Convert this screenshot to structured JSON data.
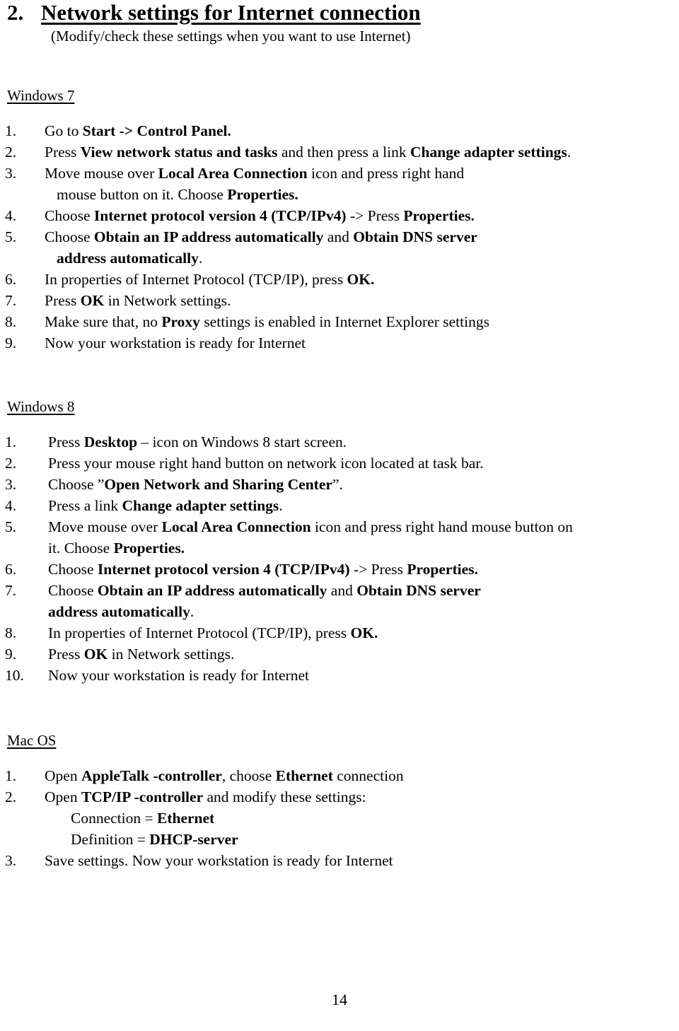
{
  "heading": {
    "number": "2.",
    "title": "Network settings for Internet connection",
    "subtitle": "(Modify/check these settings when you want to use Internet)"
  },
  "sections": [
    {
      "id": "win7",
      "heading": "Windows 7",
      "steps": [
        {
          "marker": "1.",
          "parts": [
            {
              "t": "Go to ",
              "b": false
            },
            {
              "t": "Start -> Control Panel.",
              "b": true
            }
          ]
        },
        {
          "marker": "2.",
          "parts": [
            {
              "t": "Press ",
              "b": false
            },
            {
              "t": "View network status and tasks",
              "b": true
            },
            {
              "t": " and then press a link ",
              "b": false
            },
            {
              "t": "Change adapter settings",
              "b": true
            },
            {
              "t": ".",
              "b": false
            }
          ]
        },
        {
          "marker": "3.",
          "parts": [
            {
              "t": "Move mouse over ",
              "b": false
            },
            {
              "t": "Local Area Connection",
              "b": true
            },
            {
              "t": " icon and press right hand",
              "b": false
            }
          ],
          "cont": [
            {
              "t": "mouse button on it. Choose ",
              "b": false
            },
            {
              "t": "Properties.",
              "b": true
            }
          ]
        },
        {
          "marker": "4.",
          "parts": [
            {
              "t": "Choose ",
              "b": false
            },
            {
              "t": "Internet protocol version 4 (TCP/IPv4)",
              "b": true
            },
            {
              "t": " -> Press ",
              "b": false
            },
            {
              "t": "Properties.",
              "b": true
            }
          ]
        },
        {
          "marker": "5.",
          "parts": [
            {
              "t": "Choose ",
              "b": false
            },
            {
              "t": "Obtain an IP address automatically",
              "b": true
            },
            {
              "t": " and ",
              "b": false
            },
            {
              "t": "Obtain DNS server",
              "b": true
            }
          ],
          "cont": [
            {
              "t": "address automatically",
              "b": true
            },
            {
              "t": ".",
              "b": false
            }
          ]
        },
        {
          "marker": "6.",
          "parts": [
            {
              "t": "In properties of Internet Protocol (TCP/IP), press ",
              "b": false
            },
            {
              "t": "OK.",
              "b": true
            }
          ]
        },
        {
          "marker": "7.",
          "parts": [
            {
              "t": "Press ",
              "b": false
            },
            {
              "t": "OK",
              "b": true
            },
            {
              "t": " in Network settings.",
              "b": false
            }
          ]
        },
        {
          "marker": "8.",
          "parts": [
            {
              "t": "Make sure that, no ",
              "b": false
            },
            {
              "t": "Proxy",
              "b": true
            },
            {
              "t": " settings is enabled in Internet Explorer settings",
              "b": false
            }
          ]
        },
        {
          "marker": "9.",
          "parts": [
            {
              "t": "Now your workstation is ready for Internet",
              "b": false
            }
          ]
        }
      ]
    },
    {
      "id": "win8",
      "heading": "Windows 8",
      "steps": [
        {
          "marker": "1.",
          "parts": [
            {
              "t": "Press ",
              "b": false
            },
            {
              "t": "Desktop",
              "b": true
            },
            {
              "t": " – icon on Windows 8 start screen.",
              "b": false
            }
          ]
        },
        {
          "marker": "2.",
          "parts": [
            {
              "t": "Press your mouse right hand button on network icon located at task bar.",
              "b": false
            }
          ]
        },
        {
          "marker": "3.",
          "parts": [
            {
              "t": "Choose ”",
              "b": false
            },
            {
              "t": "Open Network and Sharing Center",
              "b": true
            },
            {
              "t": "”.",
              "b": false
            }
          ]
        },
        {
          "marker": "4.",
          "parts": [
            {
              "t": "Press a link ",
              "b": false
            },
            {
              "t": "Change adapter settings",
              "b": true
            },
            {
              "t": ".",
              "b": false
            }
          ]
        },
        {
          "marker": "5.",
          "parts": [
            {
              "t": "Move mouse over ",
              "b": false
            },
            {
              "t": "Local Area Connection",
              "b": true
            },
            {
              "t": " icon and press right hand mouse button on",
              "b": false
            }
          ],
          "cont": [
            {
              "t": "it. Choose ",
              "b": false
            },
            {
              "t": "Properties.",
              "b": true
            }
          ]
        },
        {
          "marker": "6.",
          "parts": [
            {
              "t": "Choose ",
              "b": false
            },
            {
              "t": "Internet protocol version 4 (TCP/IPv4)",
              "b": true
            },
            {
              "t": " -> Press ",
              "b": false
            },
            {
              "t": "Properties.",
              "b": true
            }
          ]
        },
        {
          "marker": "7.",
          "parts": [
            {
              "t": "Choose ",
              "b": false
            },
            {
              "t": "Obtain an IP address automatically",
              "b": true
            },
            {
              "t": " and ",
              "b": false
            },
            {
              "t": "Obtain DNS server",
              "b": true
            }
          ],
          "cont": [
            {
              "t": "address automatically",
              "b": true
            },
            {
              "t": ".",
              "b": false
            }
          ]
        },
        {
          "marker": "8.",
          "parts": [
            {
              "t": "In properties of Internet Protocol (TCP/IP), press ",
              "b": false
            },
            {
              "t": "OK.",
              "b": true
            }
          ]
        },
        {
          "marker": "9.",
          "parts": [
            {
              "t": "Press ",
              "b": false
            },
            {
              "t": "OK",
              "b": true
            },
            {
              "t": " in Network settings.",
              "b": false
            }
          ]
        },
        {
          "marker": "10.",
          "parts": [
            {
              "t": "Now your workstation is ready for Internet",
              "b": false
            }
          ]
        }
      ]
    },
    {
      "id": "mac",
      "heading": "Mac OS",
      "steps": [
        {
          "marker": "1.",
          "parts": [
            {
              "t": "Open ",
              "b": false
            },
            {
              "t": "AppleTalk -controller",
              "b": true
            },
            {
              "t": ", choose ",
              "b": false
            },
            {
              "t": "Ethernet",
              "b": true
            },
            {
              "t": " connection",
              "b": false
            }
          ]
        },
        {
          "marker": "2.",
          "parts": [
            {
              "t": "Open ",
              "b": false
            },
            {
              "t": "TCP/IP -controller",
              "b": true
            },
            {
              "t": " and modify these settings:",
              "b": false
            }
          ],
          "cont": [
            {
              "t": "Connection = ",
              "b": false
            },
            {
              "t": "Ethernet",
              "b": true
            }
          ],
          "cont2": [
            {
              "t": "Definition = ",
              "b": false
            },
            {
              "t": "DHCP-server",
              "b": true
            }
          ]
        },
        {
          "marker": "3.",
          "parts": [
            {
              "t": "Save settings. Now your workstation is ready for Internet",
              "b": false
            }
          ]
        }
      ]
    }
  ],
  "footer": {
    "page_number": "14"
  }
}
